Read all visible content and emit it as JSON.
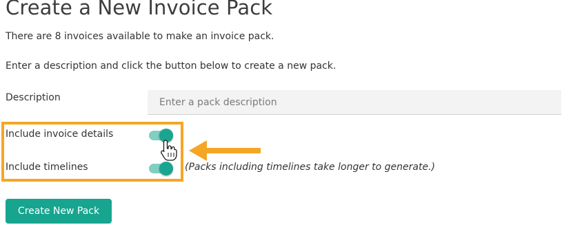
{
  "page": {
    "title": "Create a New Invoice Pack",
    "available_text": "There are 8 invoices available to make an invoice pack.",
    "instructions": "Enter a description and click the button below to create a new pack."
  },
  "form": {
    "description_label": "Description",
    "description_placeholder": "Enter a pack description",
    "description_value": "",
    "include_invoice_details_label": "Include invoice details",
    "include_invoice_details_on": true,
    "include_timelines_label": "Include timelines",
    "include_timelines_on": true,
    "timelines_hint": "(Packs including timelines take longer to generate.)",
    "submit_label": "Create New Pack"
  },
  "colors": {
    "accent": "#17a58f",
    "toggle_track": "#7fcfc2",
    "highlight": "#f5a623"
  },
  "icons": {
    "cursor": "hand-pointer-icon",
    "annotation": "arrow-left-icon"
  }
}
